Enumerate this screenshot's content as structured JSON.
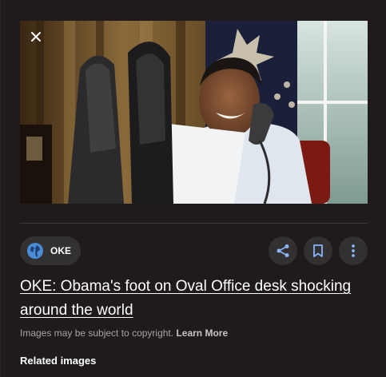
{
  "image": {
    "alt": "",
    "close_icon": "close-icon"
  },
  "source": {
    "name": "OKE",
    "icon": "globe-icon",
    "icon_color": "#4a8bd6"
  },
  "actions": {
    "share_icon": "share-icon",
    "save_icon": "bookmark-icon",
    "more_icon": "more-vert-icon",
    "accent": "#8ab4f8"
  },
  "title": "OKE: Obama's foot on Oval Office desk shocking around the world",
  "copyright": {
    "text": "Images may be subject to copyright.",
    "learn_more": "Learn More"
  },
  "related_heading": "Related images"
}
